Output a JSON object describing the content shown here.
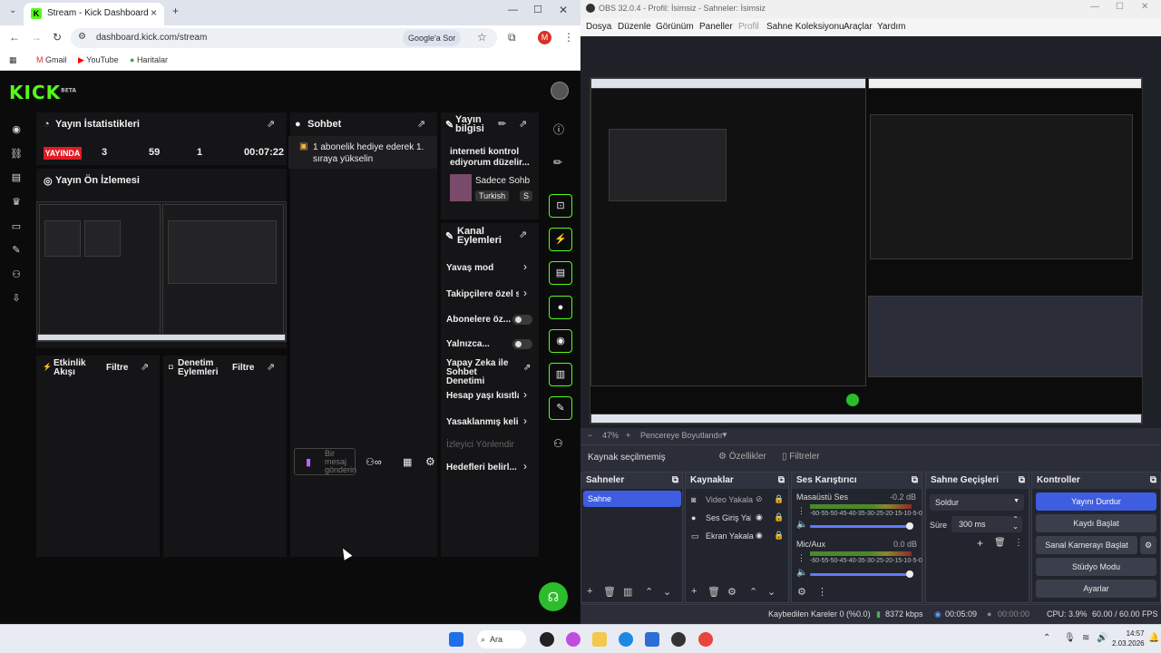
{
  "chrome": {
    "tab_title": "Stream - Kick Dashboard",
    "url": "dashboard.kick.com/stream",
    "google_search": "Google'a Sor",
    "profile_initial": "M",
    "bookmarks": [
      "Gmail",
      "YouTube",
      "Haritalar"
    ]
  },
  "kick": {
    "logo": "KICK",
    "logo_tag": "BETA",
    "stats": {
      "title": "Yayın İstatistikleri",
      "live_badge": "YAYINDA",
      "viewers": "3",
      "followers": "59",
      "subs": "1",
      "uptime": "00:07:22"
    },
    "preview_title": "Yayın Ön İzlemesi",
    "chat": {
      "title": "Sohbet",
      "message": "1 abonelik hediye ederek 1. sıraya yükselin",
      "input_placeholder": "Bir mesaj gönderin"
    },
    "stream_info": {
      "title": "Yayın bilgisi",
      "stream_title": "interneti kontrol ediyorum düzelir...",
      "category": "Sadece Sohb",
      "tag1": "Turkish",
      "tag2": "S"
    },
    "channel_actions": {
      "title": "Kanal Eylemleri",
      "items": [
        {
          "label": "Yavaş mod",
          "type": "arrow"
        },
        {
          "label": "Takipçilere özel so",
          "type": "arrow"
        },
        {
          "label": "Abonelere öz...",
          "type": "toggle"
        },
        {
          "label": "Yalnızca...",
          "type": "toggle"
        },
        {
          "label": "Yapay Zeka ile Sohbet Denetimi",
          "type": "popout"
        },
        {
          "label": "Hesap yaşı kısıtla",
          "type": "arrow"
        },
        {
          "label": "Yasaklanmış kelin",
          "type": "arrow"
        },
        {
          "label": "İzleyici Yönlendir",
          "type": "disabled"
        },
        {
          "label": "Hedefleri belirl...",
          "type": "arrow"
        }
      ]
    },
    "activity": {
      "title": "Etkinlik Akışı",
      "filter": "Filtre"
    },
    "moderation": {
      "title": "Denetim Eylemleri",
      "filter": "Filtre"
    }
  },
  "obs": {
    "window_title": "OBS 32.0.4 - Profil: İsimsiz - Sahneler: İsimsiz",
    "menu": [
      "Dosya",
      "Düzenle",
      "Görünüm",
      "Paneller",
      "Profil",
      "Sahne Koleksiyonu",
      "Araçlar",
      "Yardım"
    ],
    "zoom": "47%",
    "fit_window": "Pencereye Boyutlandır",
    "no_source": "Kaynak seçilmemiş",
    "properties": "Özellikler",
    "filters": "Filtreler",
    "scenes": {
      "title": "Sahneler",
      "items": [
        "Sahne"
      ]
    },
    "sources": {
      "title": "Kaynaklar",
      "items": [
        "Video Yakala",
        "Ses Giriş Yak.",
        "Ekran Yakala"
      ]
    },
    "mixer": {
      "title": "Ses Karıştırıcı",
      "channels": [
        {
          "name": "Masaüstü Ses",
          "db": "-0.2 dB",
          "volume": 1.0
        },
        {
          "name": "Mic/Aux",
          "db": "0.0 dB",
          "volume": 1.0
        }
      ],
      "scale": "-60-55-50-45-40-35-30-25-20-15-10-5-0"
    },
    "transitions": {
      "title": "Sahne Geçişleri",
      "type": "Soldur",
      "duration_label": "Süre",
      "duration": "300 ms"
    },
    "controls": {
      "title": "Kontroller",
      "buttons": [
        "Yayını Durdur",
        "Kaydı Başlat",
        "Sanal Kamerayı Başlat",
        "Stüdyo Modu",
        "Ayarlar"
      ]
    },
    "status": {
      "dropped": "Kaybedilen Kareler 0 (%0.0)",
      "bitrate": "8372 kbps",
      "live_time": "00:05:09",
      "rec_time": "00:00:00",
      "cpu": "CPU: 3.9%",
      "fps": "60.00 / 60.00 FPS"
    }
  },
  "taskbar": {
    "search": "Ara",
    "time": "14:57",
    "date": "2.03.2026"
  },
  "colors": {
    "kick_green": "#53fc18",
    "live_red": "#e01b24",
    "obs_accent": "#3f5de0"
  }
}
